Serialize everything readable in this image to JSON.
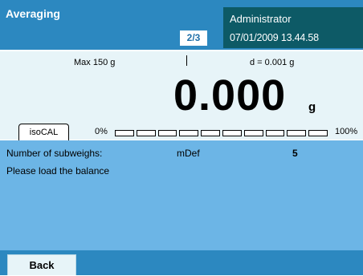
{
  "header": {
    "title": "Averaging",
    "page_indicator": "2/3",
    "user": "Administrator",
    "datetime": "07/01/2009 13.44.58",
    "colors": {
      "bar": "#2c88c0",
      "user_panel": "#0d5a66"
    }
  },
  "weighing": {
    "max_capacity": "Max 150 g",
    "readability": "d = 0.001 g",
    "value": "0.000",
    "unit": "g",
    "isocal_label": "isoCAL",
    "capacity_bar": {
      "min_label": "0%",
      "max_label": "100%",
      "fill_percent": 0,
      "segments": 10
    }
  },
  "info": {
    "subweighs_label": "Number of subweighs:",
    "subweighs_mode": "mDef",
    "subweighs_count": "5",
    "message": "Please load the balance"
  },
  "footer": {
    "back_label": "Back"
  }
}
